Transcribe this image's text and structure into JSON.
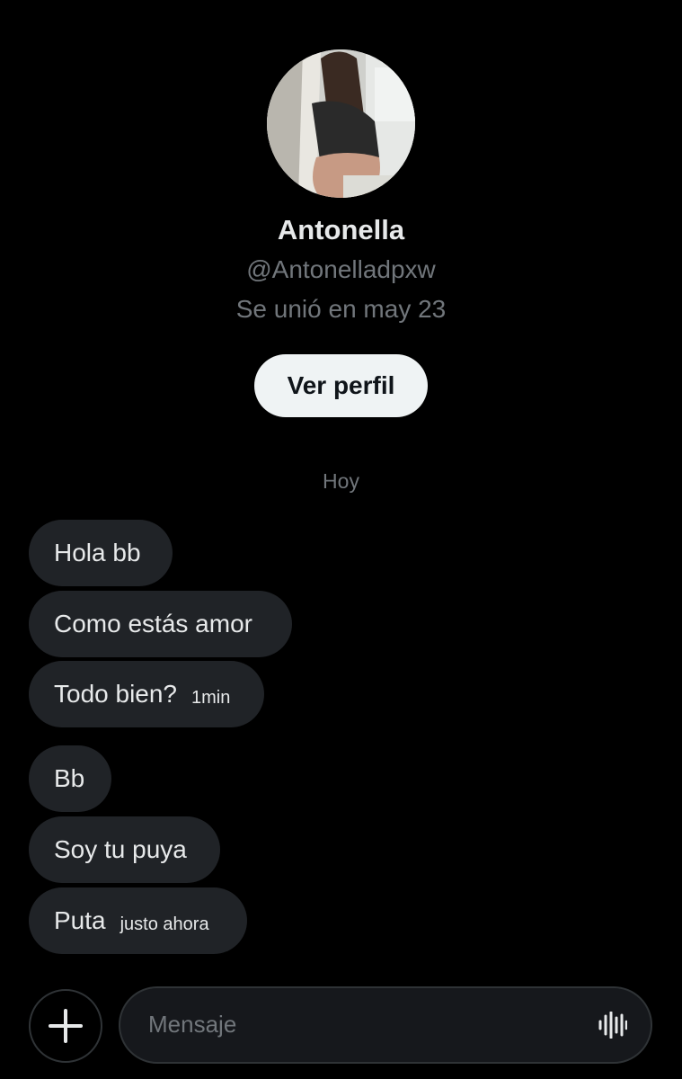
{
  "profile": {
    "name": "Antonella",
    "handle": "@Antonelladpxw",
    "joined": "Se unió en may 23",
    "view_profile_label": "Ver perfil",
    "avatar_icon": "avatar-photo"
  },
  "conversation": {
    "day_label": "Hoy",
    "messages": [
      {
        "text": "Hola bb",
        "time": ""
      },
      {
        "text": "Como estás amor",
        "time": ""
      },
      {
        "text": "Todo bien?",
        "time": "1min"
      },
      {
        "text": "Bb",
        "time": ""
      },
      {
        "text": "Soy tu puya",
        "time": ""
      },
      {
        "text": "Puta",
        "time": "justo ahora"
      }
    ]
  },
  "composer": {
    "placeholder": "Mensaje",
    "add_icon": "plus-icon",
    "voice_icon": "voice-waveform-icon"
  },
  "colors": {
    "background": "#000000",
    "bubble": "#202327",
    "muted_text": "#71767b",
    "primary_text": "#e7e9ea",
    "button_bg": "#eff3f4"
  }
}
